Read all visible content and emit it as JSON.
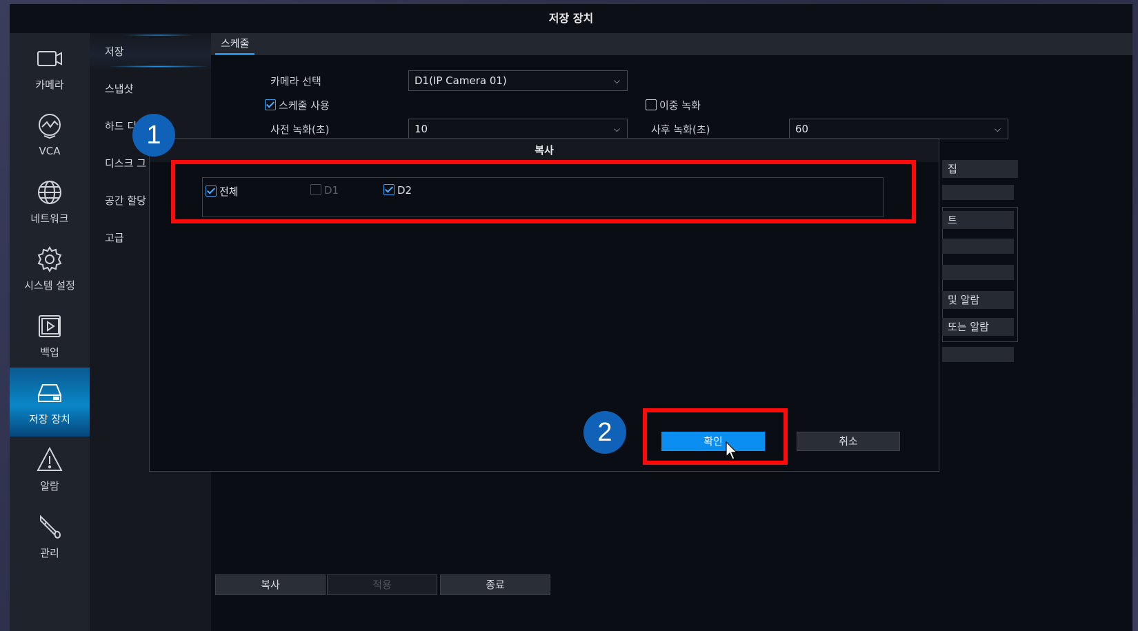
{
  "window": {
    "title": "저장 장치"
  },
  "iconbar": {
    "items": [
      {
        "label": "카메라",
        "icon": "camera-icon"
      },
      {
        "label": "VCA",
        "icon": "vca-icon"
      },
      {
        "label": "네트워크",
        "icon": "globe-icon"
      },
      {
        "label": "시스템 설정",
        "icon": "gear-icon"
      },
      {
        "label": "백업",
        "icon": "play-icon"
      },
      {
        "label": "저장 장치",
        "icon": "hdd-icon",
        "active": true
      },
      {
        "label": "알람",
        "icon": "warning-icon"
      },
      {
        "label": "관리",
        "icon": "wrench-icon"
      }
    ]
  },
  "submenu": {
    "items": [
      {
        "label": "저장",
        "active": true
      },
      {
        "label": "스냅샷"
      },
      {
        "label": "하드 디"
      },
      {
        "label": "디스크 그"
      },
      {
        "label": "공간 할당"
      },
      {
        "label": "고급"
      }
    ]
  },
  "tabs": [
    {
      "label": "스케줄"
    }
  ],
  "form": {
    "camera_label": "카메라 선택",
    "camera_value": "D1(IP Camera 01)",
    "schedule_enable_label": "스케줄 사용",
    "schedule_enabled": true,
    "dual_record_label": "이중 녹화",
    "dual_record_enabled": false,
    "pre_record_label": "사전 녹화(초)",
    "pre_record_value": "10",
    "post_record_label": "사후 녹화(초)",
    "post_record_value": "60"
  },
  "right_panel": {
    "items": [
      "집",
      "트",
      "및 알람",
      "또는 알람"
    ]
  },
  "bottom_buttons": {
    "copy": "복사",
    "apply": "적용",
    "exit": "종료"
  },
  "dialog": {
    "title": "복사",
    "options": [
      {
        "label": "전체",
        "checked": true,
        "disabled": false
      },
      {
        "label": "D1",
        "checked": false,
        "disabled": true
      },
      {
        "label": "D2",
        "checked": true,
        "disabled": false
      }
    ],
    "ok_label": "확인",
    "cancel_label": "취소"
  },
  "annotations": {
    "step1": "1",
    "step2": "2",
    "highlight_color": "#ff0a0a",
    "badge_color": "#0f62b8"
  },
  "colors": {
    "accent": "#0a8ff0",
    "active_nav": "#0a86c8"
  }
}
